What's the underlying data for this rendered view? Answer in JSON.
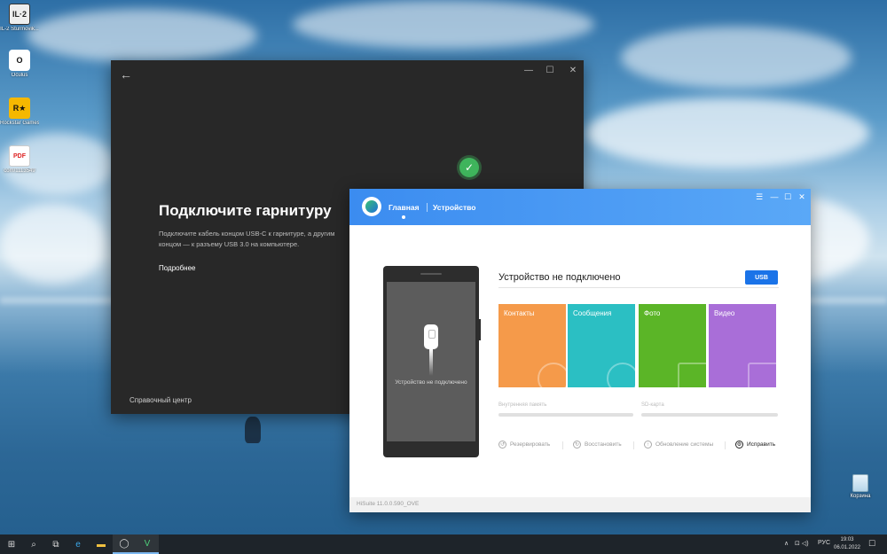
{
  "desktop": {
    "icons": [
      {
        "label": "IL-2 Sturmovik...",
        "glyph": "IL·2"
      },
      {
        "label": "Oculus",
        "glyph": "O"
      },
      {
        "label": "Rockstar Games...",
        "glyph": "R★"
      },
      {
        "label": "com/1113549",
        "glyph": "PDF"
      }
    ],
    "recycle_bin": "Корзина"
  },
  "dark_window": {
    "title": "Подключите гарнитуру",
    "description": "Подключите кабель концом USB-C к гарнитуре, а другим концом — к разъему USB 3.0 на компьютере.",
    "more_link": "Подробнее",
    "help_center": "Справочный центр",
    "controls": {
      "back": "←",
      "minimize": "—",
      "maximize": "☐",
      "close": "✕"
    },
    "check": "✓"
  },
  "hisuite": {
    "tabs": {
      "home": "Главная",
      "device": "Устройство"
    },
    "controls": {
      "menu": "☰",
      "minimize": "—",
      "maximize": "☐",
      "close": "✕"
    },
    "phone_message": "Устройство не подключено",
    "status": "Устройство не подключено",
    "usb_button": "USB",
    "tiles": [
      {
        "label": "Контакты",
        "color": "#f59a4a"
      },
      {
        "label": "Сообщения",
        "color": "#2bbfc3"
      },
      {
        "label": "Фото",
        "color": "#5bb527"
      },
      {
        "label": "Видео",
        "color": "#a96ed8"
      }
    ],
    "storage": {
      "internal": "Внутренняя память",
      "sd": "SD-карта"
    },
    "actions": [
      {
        "label": "Резервировать",
        "icon": "↺"
      },
      {
        "label": "Восстановить",
        "icon": "↻"
      },
      {
        "label": "Обновление системы",
        "icon": "↑"
      },
      {
        "label": "Исправить",
        "icon": "⚙"
      }
    ],
    "version": "HiSuite 11.0.0.590_OVE"
  },
  "taskbar": {
    "start": "⊞",
    "search": "⌕",
    "task_view": "⧉",
    "apps": [
      "e",
      "▬",
      "◯",
      "V"
    ],
    "tray": {
      "chevron": "∧",
      "icons": "⊡ ◁)",
      "language": "РУС"
    },
    "time": "19:03",
    "date": "06.01.2022",
    "notifications": "☐"
  },
  "colors": {
    "hisuite_blue": "#3b8cf0",
    "usb_button": "#1a73e8",
    "dark_window": "#282828",
    "success_green": "#3fb45c"
  }
}
